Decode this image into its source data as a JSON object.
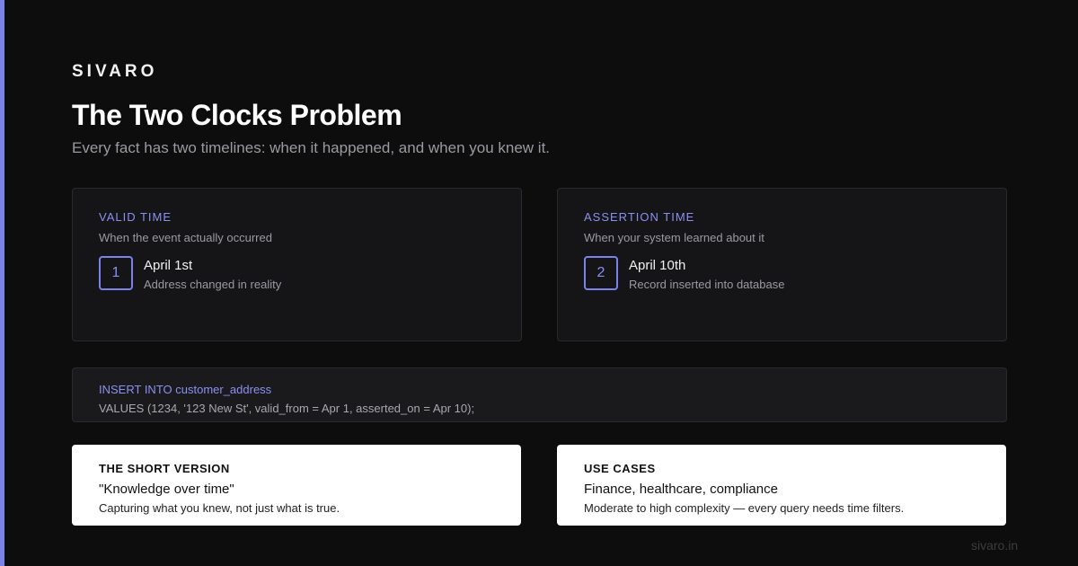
{
  "brand": "SIVARO",
  "title": "The Two Clocks Problem",
  "subtitle": "Every fact has two timelines: when it happened, and when you knew it.",
  "cards": [
    {
      "heading": "VALID TIME",
      "description": "When the event actually occurred",
      "number": "1",
      "date": "April 1st",
      "detail": "Address changed in reality"
    },
    {
      "heading": "ASSERTION TIME",
      "description": "When your system learned about it",
      "number": "2",
      "date": "April 10th",
      "detail": "Record inserted into database"
    }
  ],
  "code": {
    "line1": "INSERT INTO customer_address",
    "line2": "VALUES (1234, '123 New St', valid_from = Apr 1, asserted_on = Apr 10);"
  },
  "notes": [
    {
      "label": "THE SHORT VERSION",
      "headline": "\"Knowledge over time\"",
      "body": "Capturing what you knew, not just what is true."
    },
    {
      "label": "USE CASES",
      "headline": "Finance, healthcare, compliance",
      "body": "Moderate to high complexity — every query needs time filters."
    }
  ],
  "footer": "sivaro.in",
  "colors": {
    "accent": "#7b83ea",
    "background": "#0d0d0e",
    "card": "#151518"
  }
}
